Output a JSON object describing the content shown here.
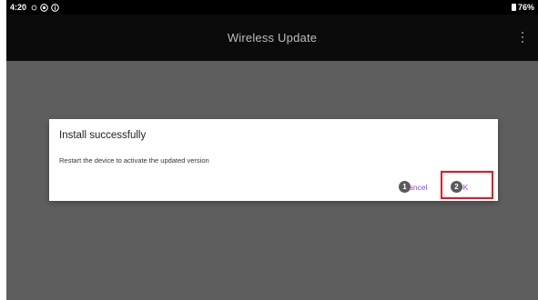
{
  "status_bar": {
    "time": "4:20",
    "icons": [
      "circle-outline-icon",
      "alert-circle-icon",
      "info-circle-icon"
    ],
    "battery_percent": "76%"
  },
  "app_bar": {
    "title": "Wireless Update",
    "overflow_icon": "more-vert-icon"
  },
  "dialog": {
    "title": "Install successfully",
    "message": "Restart the device to activate the updated version",
    "cancel_label": "Cancel",
    "ok_label": "OK"
  },
  "annotations": {
    "step_1": "1",
    "step_2": "2",
    "highlight_color": "#e8141e"
  },
  "colors": {
    "button_accent": "#8e44ec",
    "scrim": "#5e5e5e",
    "app_bar": "#0b0b0b"
  }
}
